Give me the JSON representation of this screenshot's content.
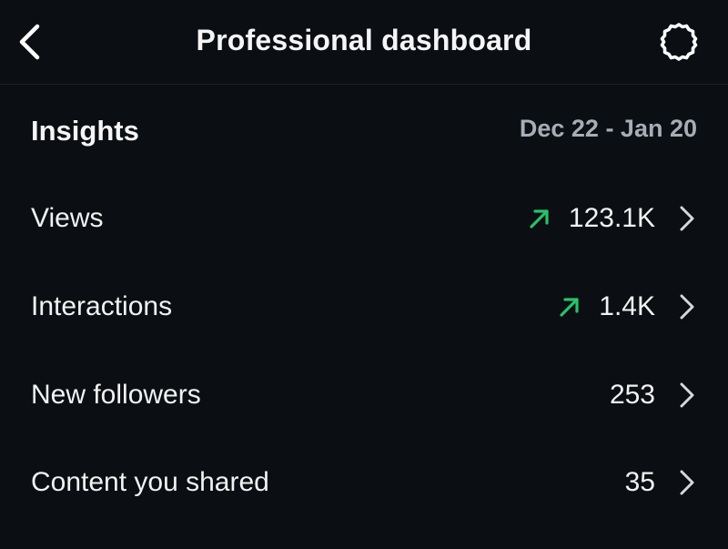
{
  "header": {
    "title": "Professional dashboard",
    "back_icon": "chevron-left-icon",
    "settings_icon": "gear-icon"
  },
  "insights": {
    "title": "Insights",
    "date_range": "Dec 22 - Jan 20"
  },
  "rows": [
    {
      "label": "Views",
      "value": "123.1K",
      "trend": "up"
    },
    {
      "label": "Interactions",
      "value": "1.4K",
      "trend": "up"
    },
    {
      "label": "New followers",
      "value": "253",
      "trend": "none"
    },
    {
      "label": "Content you shared",
      "value": "35",
      "trend": "none"
    }
  ],
  "colors": {
    "background": "#0b0e13",
    "trend_up": "#27c267",
    "muted_text": "#a7adb6"
  }
}
